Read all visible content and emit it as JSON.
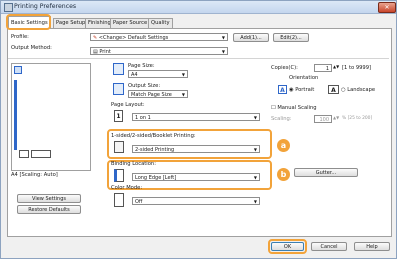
{
  "window": {
    "title": "Printing Preferences",
    "close_glyph": "✕"
  },
  "tabs": [
    "Basic Settings",
    "Page Setup",
    "Finishing",
    "Paper Source",
    "Quality"
  ],
  "profile": {
    "label": "Profile:",
    "value": "<Change> Default Settings",
    "add_label": "Add(1)...",
    "edit_label": "Edit(2)..."
  },
  "output_method": {
    "label": "Output Method:",
    "value": "Print"
  },
  "page_size": {
    "label": "Page Size:",
    "value": "A4"
  },
  "output_size": {
    "label": "Output Size:",
    "value": "Match Page Size"
  },
  "copies": {
    "label": "Copies(C):",
    "value": "1",
    "range": "[1 to 9999]"
  },
  "orientation": {
    "label": "Orientation",
    "portrait": "Portrait",
    "landscape": "Landscape",
    "icon_letter": "A"
  },
  "page_layout": {
    "label": "Page Layout:",
    "value": "1 on 1",
    "icon_number": "1"
  },
  "manual_scaling": {
    "label": "Manual Scaling",
    "scaling_label": "Scaling:",
    "scaling_value": "100",
    "scaling_range": "% [25 to 200]"
  },
  "duplex": {
    "label": "1-sided/2-sided/Booklet Printing:",
    "value": "2-sided Printing"
  },
  "binding": {
    "label": "Binding Location:",
    "value": "Long Edge [Left]",
    "gutter_label": "Gutter..."
  },
  "color_mode": {
    "label": "Color Mode:",
    "value": "Off"
  },
  "preview": {
    "caption": "A4 [Scaling: Auto]"
  },
  "left_buttons": {
    "view_settings": "View Settings",
    "restore_defaults": "Restore Defaults"
  },
  "markers": {
    "a": "a",
    "b": "b"
  },
  "footer": {
    "ok": "OK",
    "cancel": "Cancel",
    "help": "Help"
  },
  "colors": {
    "highlight": "#f2a33a",
    "accent_blue": "#2f67c9",
    "title_bar": "#c4d6ee"
  }
}
